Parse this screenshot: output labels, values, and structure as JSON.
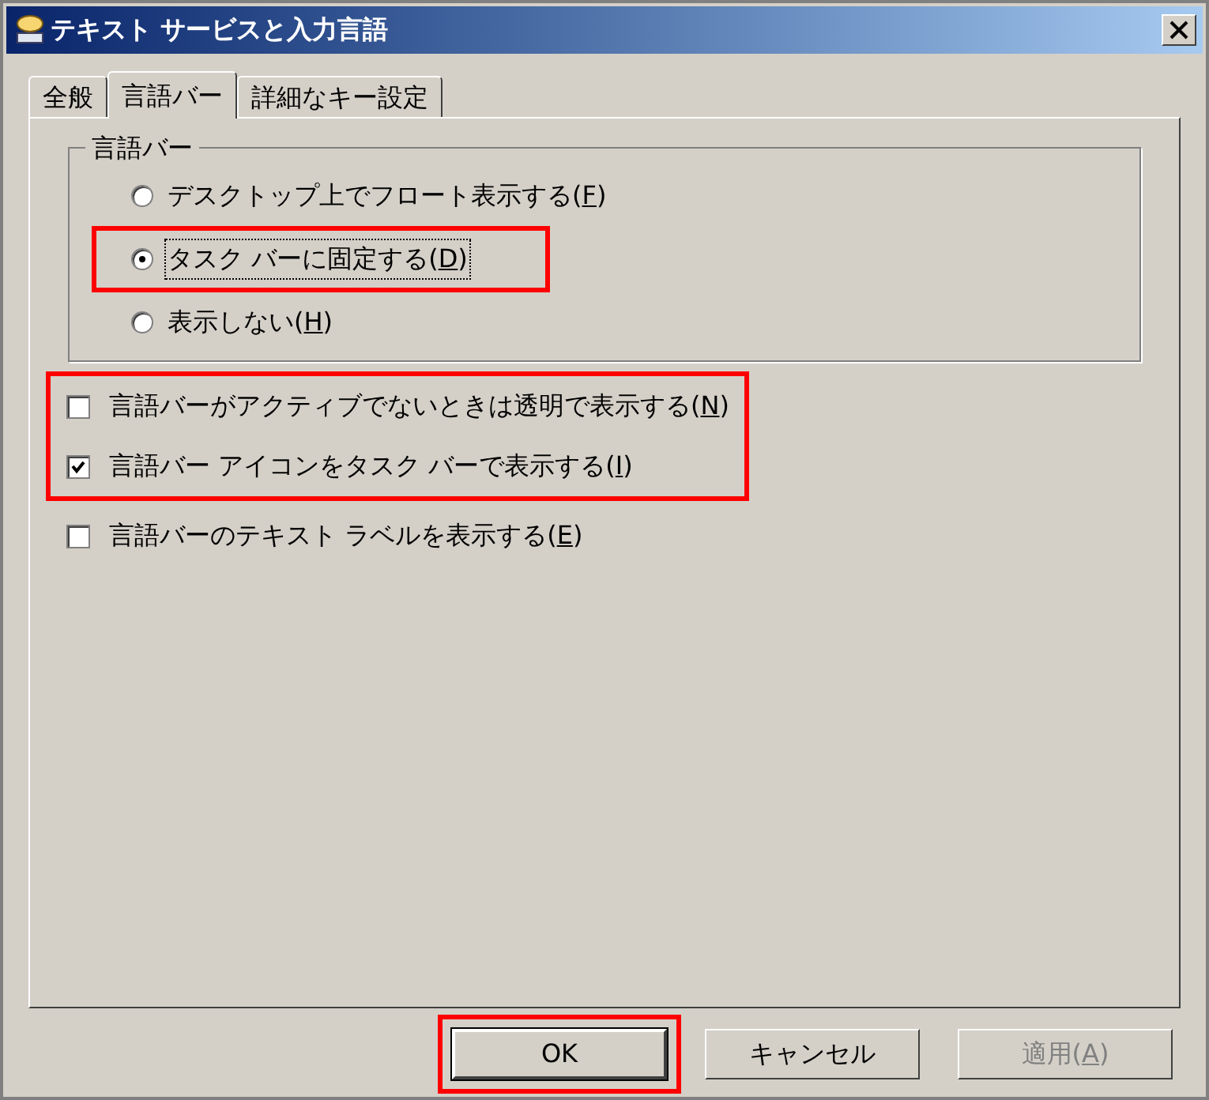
{
  "window": {
    "title": "テキスト サービスと入力言語"
  },
  "tabs": [
    {
      "label": "全般",
      "selected": false
    },
    {
      "label": "言語バー",
      "selected": true
    },
    {
      "label": "詳細なキー設定",
      "selected": false
    }
  ],
  "group": {
    "title": "言語バー",
    "radios": [
      {
        "label": "デスクトップ上でフロート表示する(F)",
        "selected": false,
        "highlighted": false,
        "focused": false
      },
      {
        "label": "タスク バーに固定する(D)",
        "selected": true,
        "highlighted": true,
        "focused": true
      },
      {
        "label": "表示しない(H)",
        "selected": false,
        "highlighted": false,
        "focused": false
      }
    ]
  },
  "checkbox_groups": [
    {
      "highlighted": true,
      "items": [
        {
          "label": "言語バーがアクティブでないときは透明で表示する(N)",
          "checked": false
        },
        {
          "label": "言語バー アイコンをタスク バーで表示する(I)",
          "checked": true
        }
      ]
    },
    {
      "highlighted": false,
      "items": [
        {
          "label": "言語バーのテキスト ラベルを表示する(E)",
          "checked": false
        }
      ]
    }
  ],
  "buttons": [
    {
      "label": "OK",
      "default": true,
      "disabled": false,
      "highlighted": true
    },
    {
      "label": "キャンセル",
      "default": false,
      "disabled": false,
      "highlighted": false
    },
    {
      "label": "適用(A)",
      "default": false,
      "disabled": true,
      "highlighted": false
    }
  ]
}
